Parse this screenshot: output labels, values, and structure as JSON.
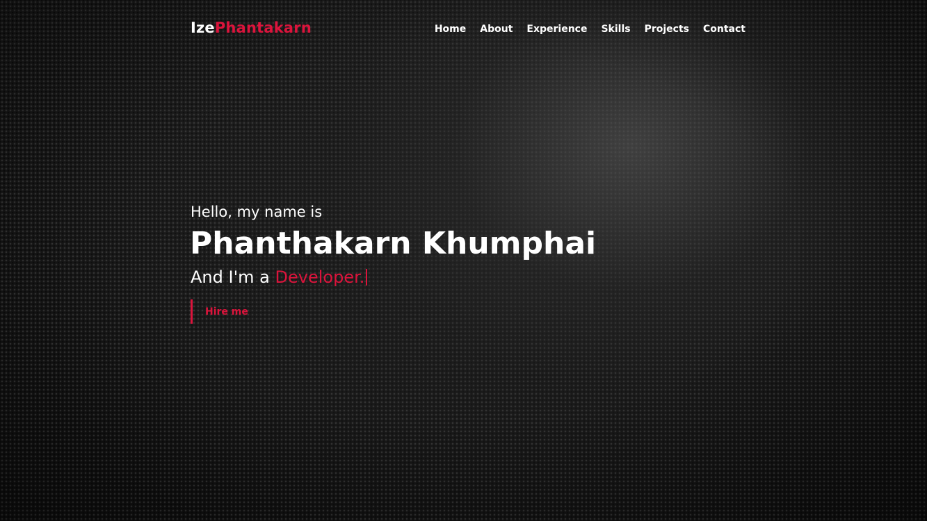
{
  "nav": {
    "logo_first": "Ize",
    "logo_second": "Phantakarn",
    "items": [
      {
        "label": "Home"
      },
      {
        "label": "About"
      },
      {
        "label": "Experience"
      },
      {
        "label": "Skills"
      },
      {
        "label": "Projects"
      },
      {
        "label": "Contact"
      }
    ]
  },
  "hero": {
    "greeting": "Hello, my name is",
    "name": "Phanthakarn Khumphai",
    "tagline_prefix": "And I'm a",
    "role": "Developer.",
    "hire_label": "Hire me"
  },
  "colors": {
    "accent": "#dc143c",
    "text": "#ffffff",
    "background": "#141414"
  }
}
